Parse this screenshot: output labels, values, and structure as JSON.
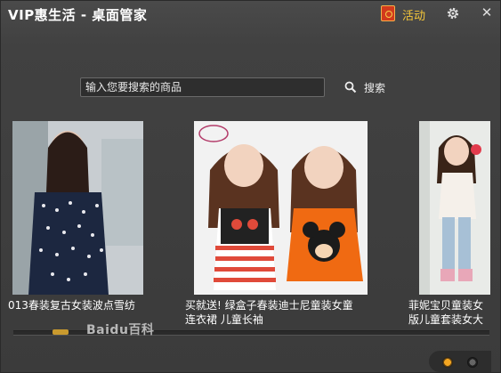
{
  "window": {
    "title": "VIP惠生活 - 桌面管家",
    "activity_label": "活动"
  },
  "search": {
    "placeholder": "输入您要搜索的商品",
    "button_label": "搜索"
  },
  "products": [
    {
      "caption": "013春装复古女装波点雪纺"
    },
    {
      "caption_line1": "买就送! 绿盒子春装迪士尼童装女童",
      "caption_line2": "连衣裙 儿童长袖"
    },
    {
      "caption_line1": "菲妮宝贝童装女",
      "caption_line2": "版儿童套装女大"
    }
  ],
  "watermark": "Baidu百科",
  "carousel": {
    "page_count": 2,
    "active_index": 0
  },
  "colors": {
    "accent": "#f5c73a",
    "background": "#3b3b3b",
    "thumb": "#c99a2e"
  }
}
